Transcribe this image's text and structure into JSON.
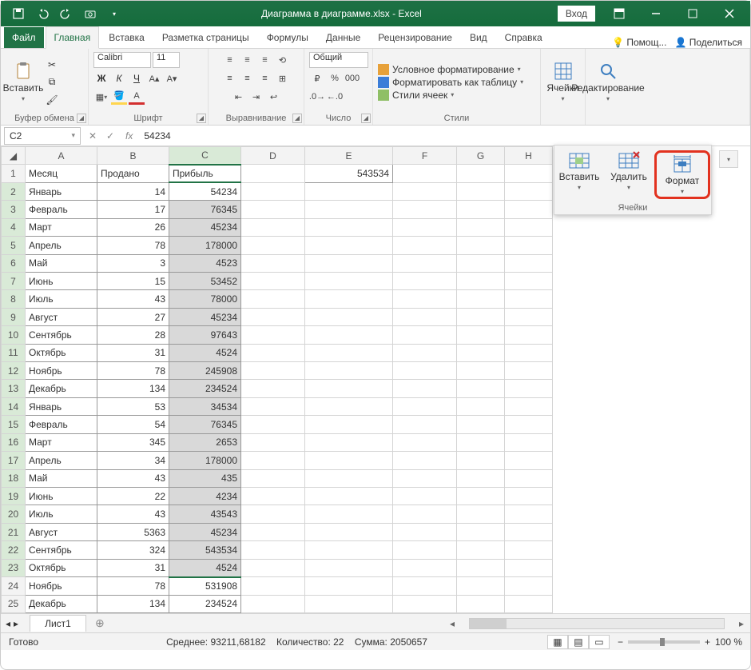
{
  "window": {
    "title": "Диаграмма в диаграмме.xlsx - Excel",
    "signin": "Вход"
  },
  "tabs": {
    "file": "Файл",
    "home": "Главная",
    "insert": "Вставка",
    "layout": "Разметка страницы",
    "formulas": "Формулы",
    "data": "Данные",
    "review": "Рецензирование",
    "view": "Вид",
    "help": "Справка",
    "tellme": "Помощ...",
    "share": "Поделиться"
  },
  "ribbon": {
    "clipboard": {
      "label": "Буфер обмена",
      "paste": "Вставить"
    },
    "font": {
      "label": "Шрифт",
      "name": "Calibri",
      "size": "11"
    },
    "align": {
      "label": "Выравнивание"
    },
    "number": {
      "label": "Число",
      "format": "Общий"
    },
    "styles": {
      "label": "Стили",
      "cond": "Условное форматирование",
      "tbl": "Форматировать как таблицу",
      "cell": "Стили ячеек"
    },
    "cells": {
      "label": "Ячейки"
    },
    "editing": {
      "label": "Редактирование"
    }
  },
  "cellspop": {
    "insert": "Вставить",
    "delete": "Удалить",
    "format": "Формат",
    "label": "Ячейки"
  },
  "fbar": {
    "name": "C2",
    "value": "54234"
  },
  "cols": [
    "A",
    "B",
    "C",
    "D",
    "E",
    "F",
    "G",
    "H"
  ],
  "headers": {
    "A": "Месяц",
    "B": "Продано",
    "C": "Прибыль",
    "E": "543534"
  },
  "rows": [
    {
      "r": 2,
      "A": "Январь",
      "B": "14",
      "C": "54234"
    },
    {
      "r": 3,
      "A": "Февраль",
      "B": "17",
      "C": "76345"
    },
    {
      "r": 4,
      "A": "Март",
      "B": "26",
      "C": "45234"
    },
    {
      "r": 5,
      "A": "Апрель",
      "B": "78",
      "C": "178000"
    },
    {
      "r": 6,
      "A": "Май",
      "B": "3",
      "C": "4523"
    },
    {
      "r": 7,
      "A": "Июнь",
      "B": "15",
      "C": "53452"
    },
    {
      "r": 8,
      "A": "Июль",
      "B": "43",
      "C": "78000"
    },
    {
      "r": 9,
      "A": "Август",
      "B": "27",
      "C": "45234"
    },
    {
      "r": 10,
      "A": "Сентябрь",
      "B": "28",
      "C": "97643"
    },
    {
      "r": 11,
      "A": "Октябрь",
      "B": "31",
      "C": "4524"
    },
    {
      "r": 12,
      "A": "Ноябрь",
      "B": "78",
      "C": "245908"
    },
    {
      "r": 13,
      "A": "Декабрь",
      "B": "134",
      "C": "234524"
    },
    {
      "r": 14,
      "A": "Январь",
      "B": "53",
      "C": "34534"
    },
    {
      "r": 15,
      "A": "Февраль",
      "B": "54",
      "C": "76345"
    },
    {
      "r": 16,
      "A": "Март",
      "B": "345",
      "C": "2653"
    },
    {
      "r": 17,
      "A": "Апрель",
      "B": "34",
      "C": "178000"
    },
    {
      "r": 18,
      "A": "Май",
      "B": "43",
      "C": "435"
    },
    {
      "r": 19,
      "A": "Июнь",
      "B": "22",
      "C": "4234"
    },
    {
      "r": 20,
      "A": "Июль",
      "B": "43",
      "C": "43543"
    },
    {
      "r": 21,
      "A": "Август",
      "B": "5363",
      "C": "45234"
    },
    {
      "r": 22,
      "A": "Сентябрь",
      "B": "324",
      "C": "543534"
    },
    {
      "r": 23,
      "A": "Октябрь",
      "B": "31",
      "C": "4524"
    },
    {
      "r": 24,
      "A": "Ноябрь",
      "B": "78",
      "C": "531908"
    },
    {
      "r": 25,
      "A": "Декабрь",
      "B": "134",
      "C": "234524"
    }
  ],
  "sheet": {
    "name": "Лист1"
  },
  "status": {
    "ready": "Готово",
    "avg_l": "Среднее:",
    "avg_v": "93211,68182",
    "cnt_l": "Количество:",
    "cnt_v": "22",
    "sum_l": "Сумма:",
    "sum_v": "2050657",
    "zoom": "100 %"
  }
}
